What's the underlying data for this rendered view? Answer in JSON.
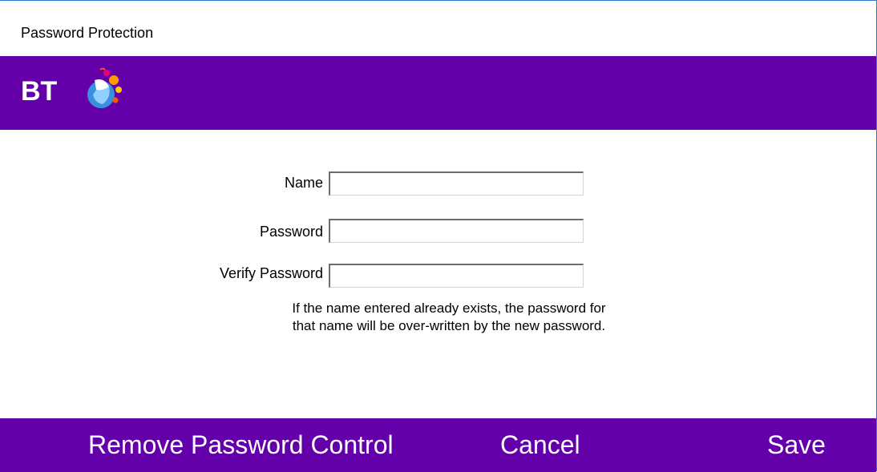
{
  "window": {
    "title": "Password Protection"
  },
  "banner": {
    "background": "#6400aa",
    "logo": {
      "text": "BT",
      "icon": "bt-globe-logo"
    }
  },
  "form": {
    "name_label": "Name",
    "name_value": "",
    "password_label": "Password",
    "password_value": "",
    "verify_label": "Verify Password",
    "verify_value": "",
    "note_line1": "If the name entered already exists, the password for",
    "note_line2": "that name will be over-written by the new password."
  },
  "footer": {
    "background": "#6400aa",
    "remove_label": "Remove Password Control",
    "cancel_label": "Cancel",
    "save_label": "Save"
  }
}
